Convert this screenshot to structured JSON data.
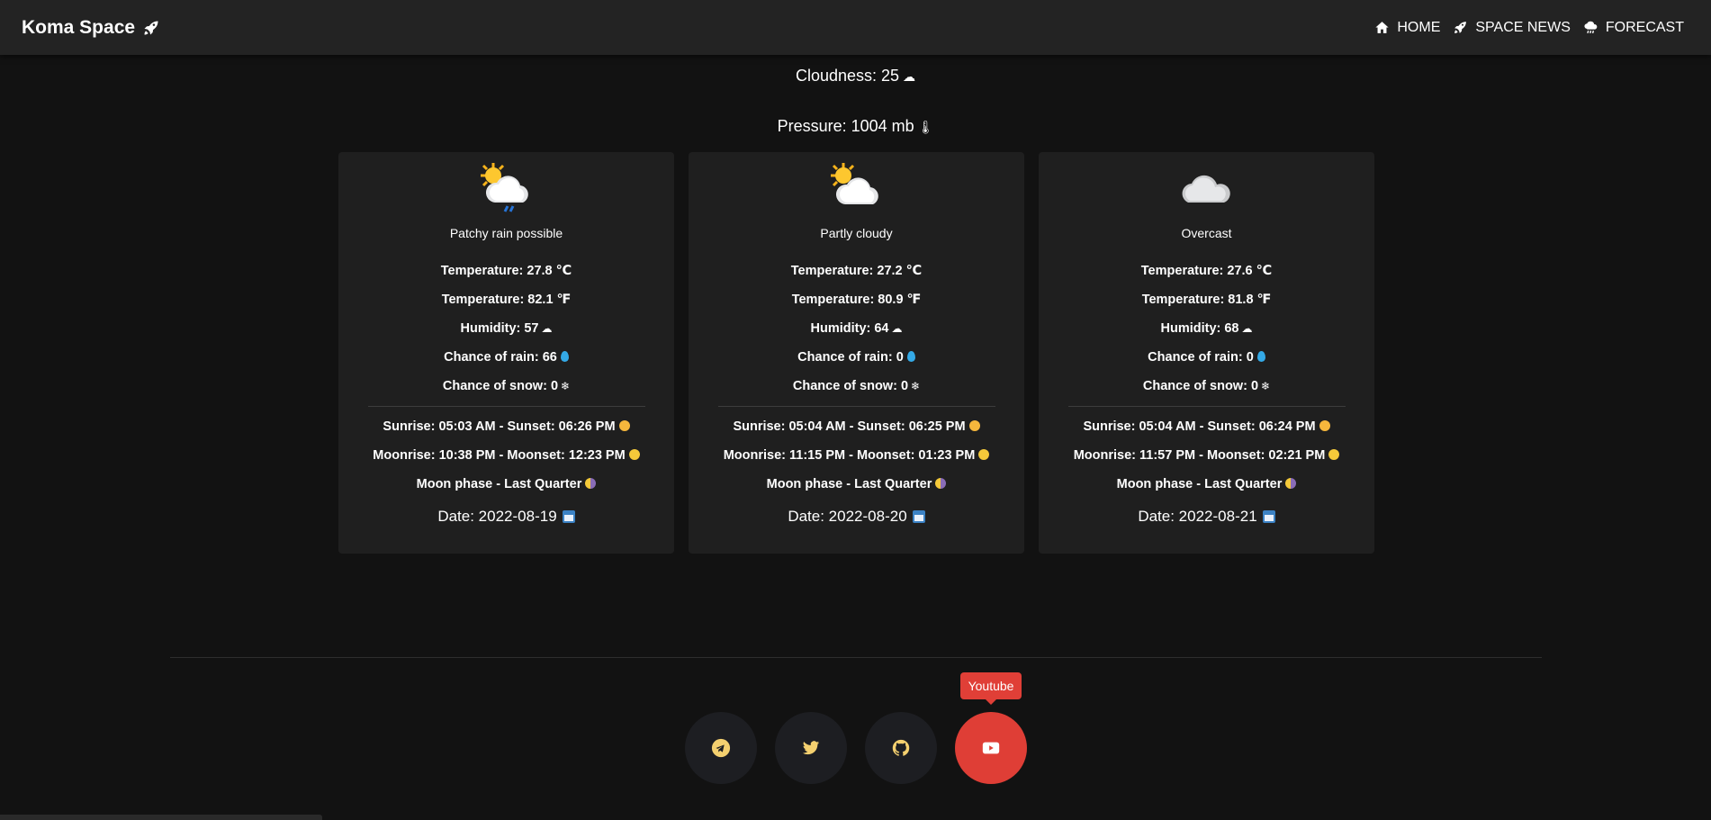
{
  "brand": {
    "name": "Koma Space",
    "icon": "rocket-icon"
  },
  "nav": [
    {
      "label": "HOME",
      "icon": "home-icon"
    },
    {
      "label": "SPACE NEWS",
      "icon": "rocket-icon"
    },
    {
      "label": "FORECAST",
      "icon": "storm-cloud-icon"
    }
  ],
  "summary": {
    "cloudiness": "Cloudness: 25",
    "pressure": "Pressure: 1004 mb"
  },
  "forecast": [
    {
      "condition": "Patchy rain possible",
      "icon": "sun-cloud-rain-icon",
      "temp_c": "Temperature: 27.8 ℃",
      "temp_f": "Temperature: 82.1 ℉",
      "humidity": "Humidity: 57",
      "rain": "Chance of rain: 66",
      "snow": "Chance of snow: 0",
      "sun": "Sunrise: 05:03 AM - Sunset: 06:26 PM",
      "moon": "Moonrise: 10:38 PM - Moonset: 12:23 PM",
      "phase": "Moon phase - Last Quarter",
      "date": "Date: 2022-08-19"
    },
    {
      "condition": "Partly cloudy",
      "icon": "sun-cloud-icon",
      "temp_c": "Temperature: 27.2 ℃",
      "temp_f": "Temperature: 80.9 ℉",
      "humidity": "Humidity: 64",
      "rain": "Chance of rain: 0",
      "snow": "Chance of snow: 0",
      "sun": "Sunrise: 05:04 AM - Sunset: 06:25 PM",
      "moon": "Moonrise: 11:15 PM - Moonset: 01:23 PM",
      "phase": "Moon phase - Last Quarter",
      "date": "Date: 2022-08-20"
    },
    {
      "condition": "Overcast",
      "icon": "cloud-icon",
      "temp_c": "Temperature: 27.6 ℃",
      "temp_f": "Temperature: 81.8 ℉",
      "humidity": "Humidity: 68",
      "rain": "Chance of rain: 0",
      "snow": "Chance of snow: 0",
      "sun": "Sunrise: 05:04 AM - Sunset: 06:24 PM",
      "moon": "Moonrise: 11:57 PM - Moonset: 02:21 PM",
      "phase": "Moon phase - Last Quarter",
      "date": "Date: 2022-08-21"
    }
  ],
  "socials": [
    {
      "name": "Telegram",
      "icon": "telegram-icon"
    },
    {
      "name": "Twitter",
      "icon": "twitter-icon"
    },
    {
      "name": "Github",
      "icon": "github-icon"
    },
    {
      "name": "Youtube",
      "icon": "youtube-icon"
    }
  ],
  "tooltip": {
    "label": "Youtube"
  },
  "colors": {
    "accent": "#df3e36",
    "icon_gold": "#f4d06f",
    "background": "#121212",
    "card": "#1f1f1f"
  }
}
